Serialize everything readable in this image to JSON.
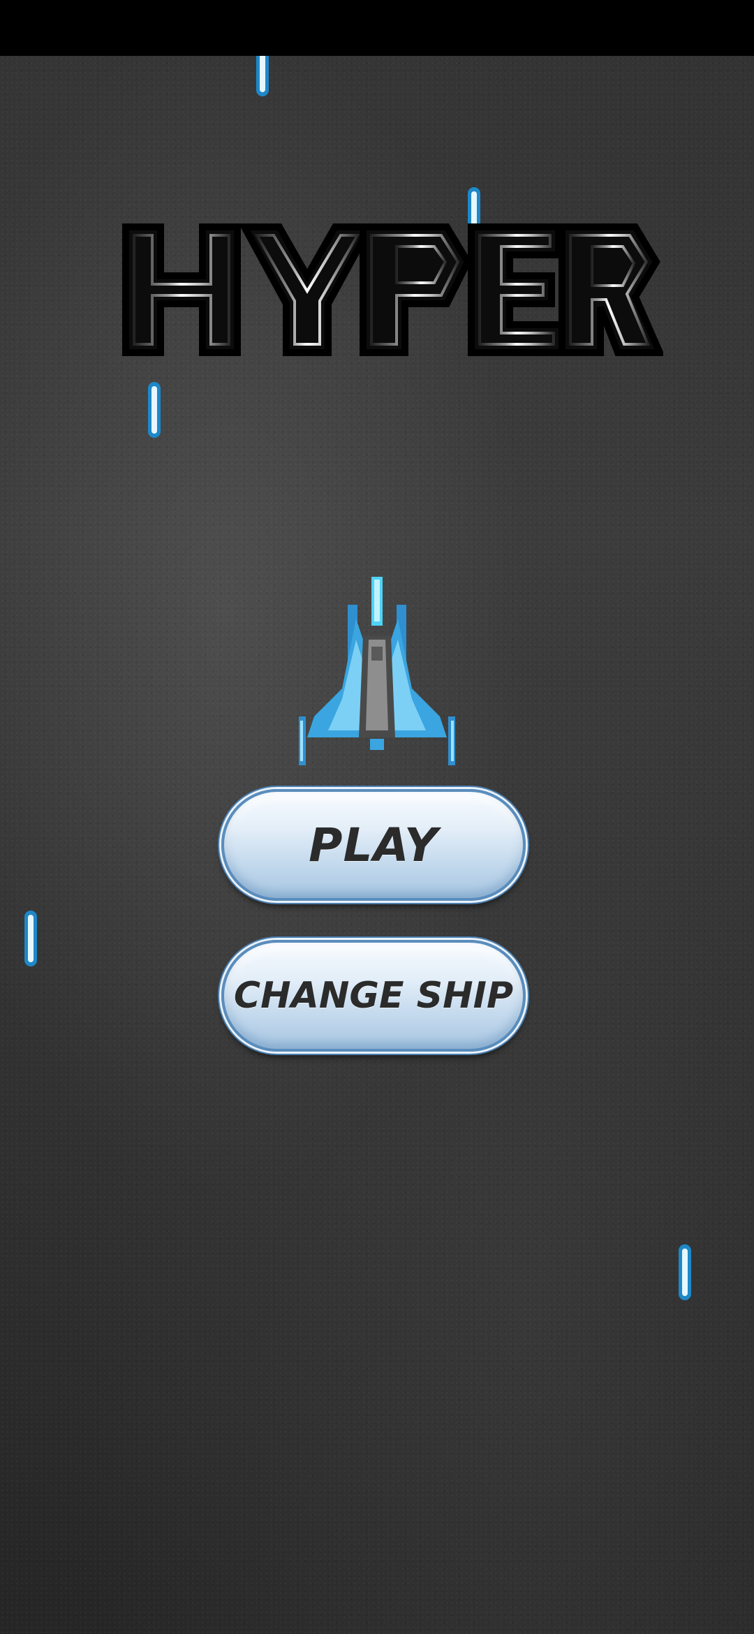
{
  "game": {
    "title": "HYPER"
  },
  "menu": {
    "play_label": "PLAY",
    "change_ship_label": "CHANGE SHIP"
  },
  "colors": {
    "laser": "#29b6f6",
    "button_border": "#4b7fb0",
    "ship_body": "#4fb3e8"
  }
}
